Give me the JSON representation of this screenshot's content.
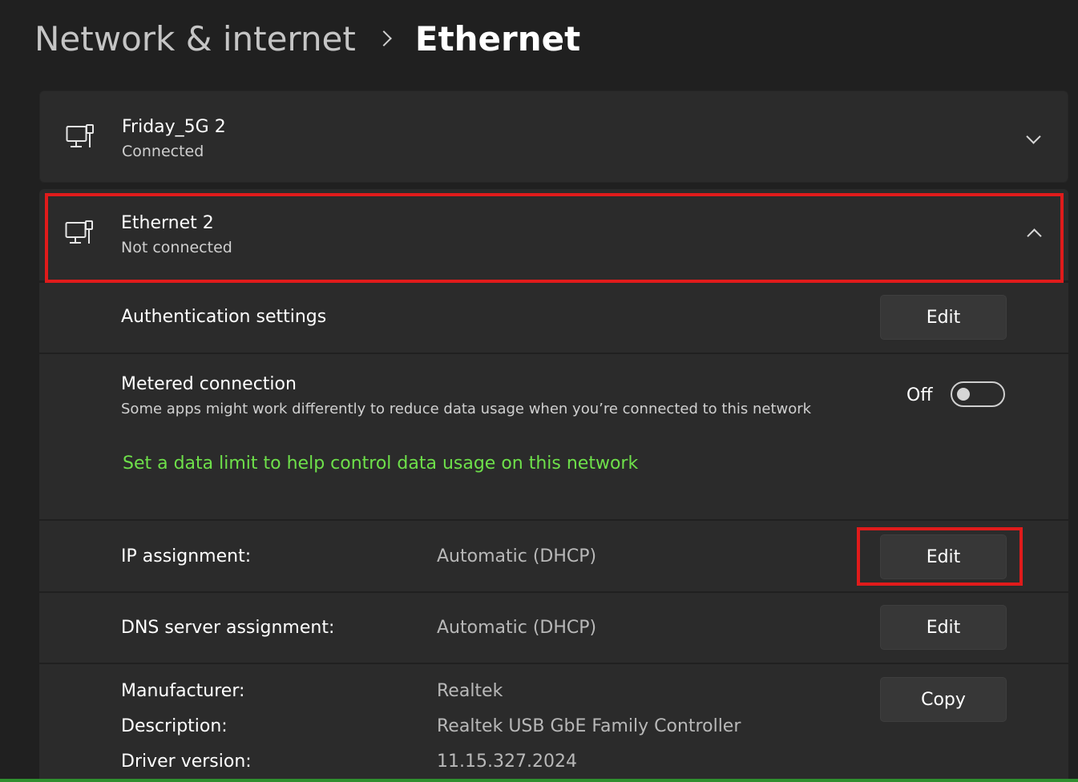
{
  "breadcrumb": {
    "parent": "Network & internet",
    "current": "Ethernet"
  },
  "networks": [
    {
      "name": "Friday_5G 2",
      "status": "Connected",
      "icon": "ethernet-icon",
      "expanded": false
    },
    {
      "name": "Ethernet 2",
      "status": "Not connected",
      "icon": "ethernet-icon",
      "expanded": true
    }
  ],
  "auth": {
    "label": "Authentication settings",
    "button": "Edit"
  },
  "metered": {
    "label": "Metered connection",
    "description": "Some apps might work differently to reduce data usage when you’re connected to this network",
    "toggle_state": "Off",
    "toggle_on": false,
    "link": "Set a data limit to help control data usage on this network"
  },
  "ip": {
    "label": "IP assignment:",
    "value": "Automatic (DHCP)",
    "button": "Edit"
  },
  "dns": {
    "label": "DNS server assignment:",
    "value": "Automatic (DHCP)",
    "button": "Edit"
  },
  "properties": {
    "button": "Copy",
    "items": [
      {
        "label": "Manufacturer:",
        "value": "Realtek"
      },
      {
        "label": "Description:",
        "value": "Realtek USB GbE Family Controller"
      },
      {
        "label": "Driver version:",
        "value": "11.15.327.2024"
      }
    ]
  },
  "colors": {
    "background": "#202020",
    "card": "#2b2b2b",
    "link": "#6ee04a",
    "highlight": "#e01b1b"
  }
}
